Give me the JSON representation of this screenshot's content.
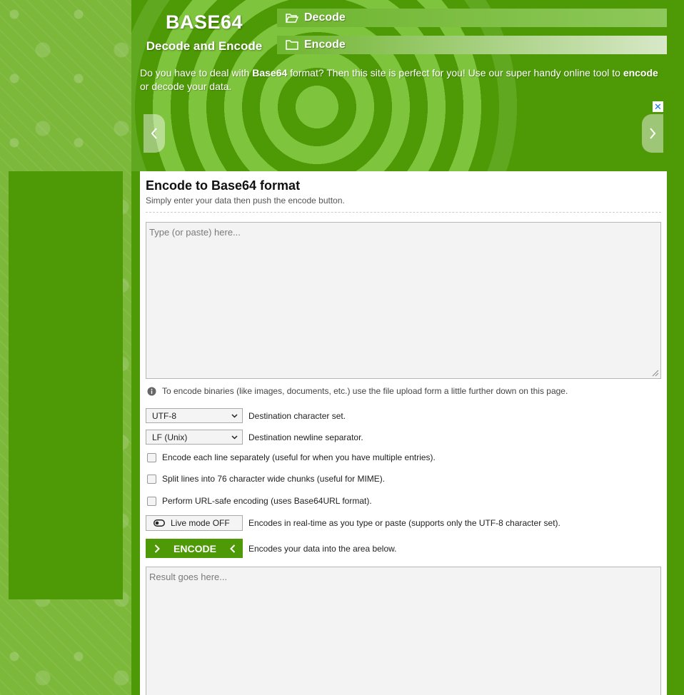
{
  "brand": {
    "title": "BASE64",
    "subtitle": "Decode and Encode"
  },
  "nav": {
    "decode_label": "Decode",
    "encode_label": "Encode"
  },
  "intro": {
    "part1": "Do you have to deal with ",
    "bold1": "Base64",
    "part2": " format? Then this site is perfect for you! Use our super handy online tool to ",
    "bold2": "encode",
    "part3": " or decode your data."
  },
  "ad": {
    "close_label": "✕"
  },
  "main": {
    "title": "Encode to Base64 format",
    "subtitle": "Simply enter your data then push the encode button.",
    "input_placeholder": "Type (or paste) here...",
    "info_text": "To encode binaries (like images, documents, etc.) use the file upload form a little further down on this page.",
    "charset": {
      "value": "UTF-8",
      "label": "Destination character set."
    },
    "newline": {
      "value": "LF (Unix)",
      "label": "Destination newline separator."
    },
    "options": [
      "Encode each line separately (useful for when you have multiple entries).",
      "Split lines into 76 character wide chunks (useful for MIME).",
      "Perform URL-safe encoding (uses Base64URL format)."
    ],
    "live_mode": {
      "label": "Live mode OFF",
      "description": "Encodes in real-time as you type or paste (supports only the UTF-8 character set)."
    },
    "encode_button": {
      "label": "ENCODE",
      "description": "Encodes your data into the area below."
    },
    "result_placeholder": "Result goes here..."
  },
  "colors": {
    "brand_green": "#4e9a06",
    "light_green": "#7cb83a",
    "link_blue": "#1a73e8"
  }
}
